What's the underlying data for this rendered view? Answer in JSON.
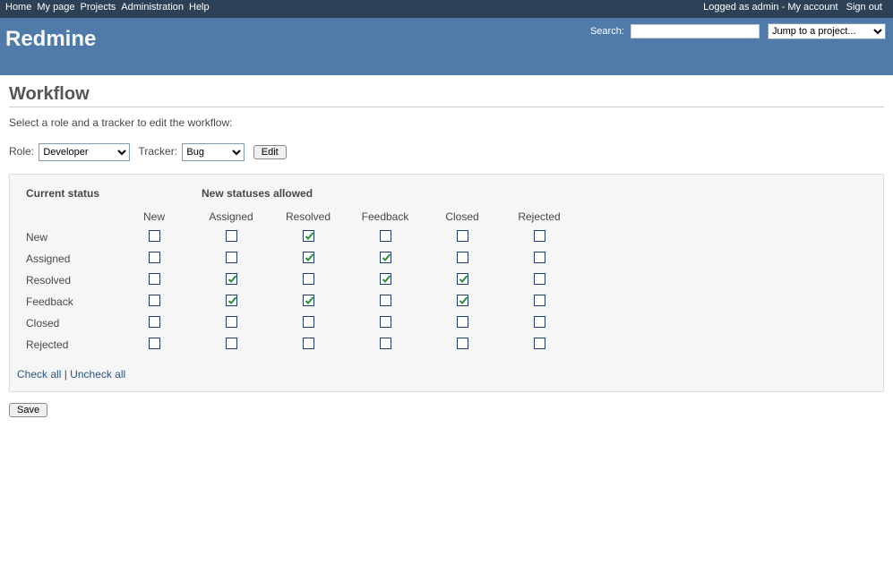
{
  "topMenu": {
    "left": [
      "Home",
      "My page",
      "Projects",
      "Administration",
      "Help"
    ],
    "loggedAs": "Logged as admin",
    "myAccount": "My account",
    "signOut": "Sign out"
  },
  "header": {
    "appTitle": "Redmine",
    "searchLabel": "Search:",
    "searchValue": "",
    "projectJump": {
      "selected": "Jump to a project..."
    }
  },
  "page": {
    "title": "Workflow",
    "intro": "Select a role and a tracker to edit the workflow:",
    "roleLabel": "Role:",
    "roleSelected": "Developer",
    "trackerLabel": "Tracker:",
    "trackerSelected": "Bug",
    "editBtn": "Edit",
    "saveBtn": "Save",
    "checkAll": "Check all",
    "sep": " | ",
    "uncheckAll": "Uncheck all"
  },
  "table": {
    "headCurrent": "Current status",
    "headNew": "New statuses allowed",
    "columns": [
      "New",
      "Assigned",
      "Resolved",
      "Feedback",
      "Closed",
      "Rejected"
    ],
    "rows": [
      {
        "name": "New",
        "checks": [
          false,
          false,
          true,
          false,
          false,
          false
        ]
      },
      {
        "name": "Assigned",
        "checks": [
          false,
          false,
          true,
          true,
          false,
          false
        ]
      },
      {
        "name": "Resolved",
        "checks": [
          false,
          true,
          false,
          true,
          true,
          false
        ]
      },
      {
        "name": "Feedback",
        "checks": [
          false,
          true,
          true,
          false,
          true,
          false
        ]
      },
      {
        "name": "Closed",
        "checks": [
          false,
          false,
          false,
          false,
          false,
          false
        ]
      },
      {
        "name": "Rejected",
        "checks": [
          false,
          false,
          false,
          false,
          false,
          false
        ]
      }
    ]
  }
}
